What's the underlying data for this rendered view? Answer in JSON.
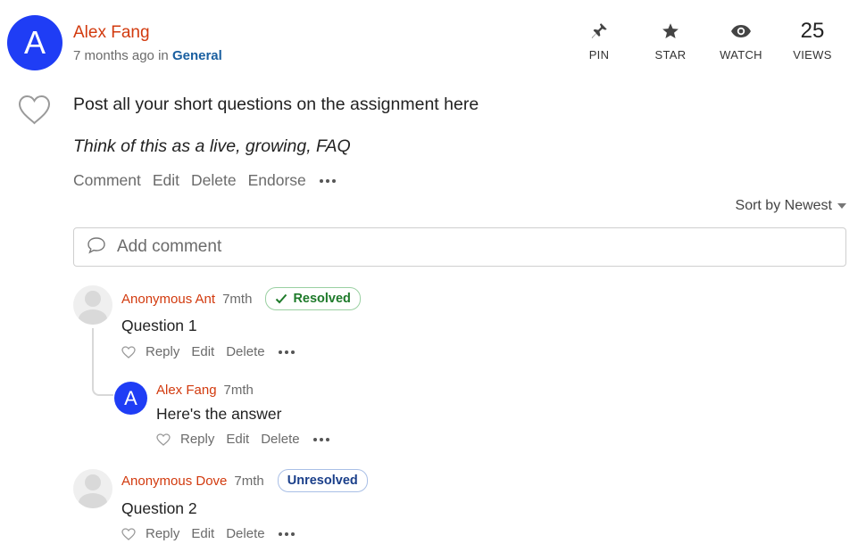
{
  "post": {
    "avatar_letter": "A",
    "author": "Alex Fang",
    "time": "7 months ago",
    "in_word": "in",
    "category": "General",
    "title": "Post all your short questions on the assignment here",
    "subtitle": "Think of this as a live, growing, FAQ",
    "actions": [
      "Comment",
      "Edit",
      "Delete",
      "Endorse"
    ]
  },
  "header_actions": {
    "pin": "PIN",
    "star": "STAR",
    "watch": "WATCH",
    "views_count": "25",
    "views": "VIEWS"
  },
  "sort": {
    "label": "Sort by Newest"
  },
  "comment_box": {
    "placeholder": "Add comment"
  },
  "comments": [
    {
      "author": "Anonymous Ant",
      "time": "7mth",
      "badge": "Resolved",
      "text": "Question 1",
      "actions": [
        "Reply",
        "Edit",
        "Delete"
      ],
      "reply": {
        "avatar_letter": "A",
        "author": "Alex Fang",
        "time": "7mth",
        "text": "Here's the answer",
        "actions": [
          "Reply",
          "Edit",
          "Delete"
        ]
      }
    },
    {
      "author": "Anonymous Dove",
      "time": "7mth",
      "badge": "Unresolved",
      "text": "Question 2",
      "actions": [
        "Reply",
        "Edit",
        "Delete"
      ]
    }
  ],
  "colors": {
    "author": "#d23a0e",
    "category": "#1a5fa0",
    "avatar": "#1f3df5",
    "resolved": "#1e7a2a",
    "unresolved": "#1a3f8a"
  }
}
